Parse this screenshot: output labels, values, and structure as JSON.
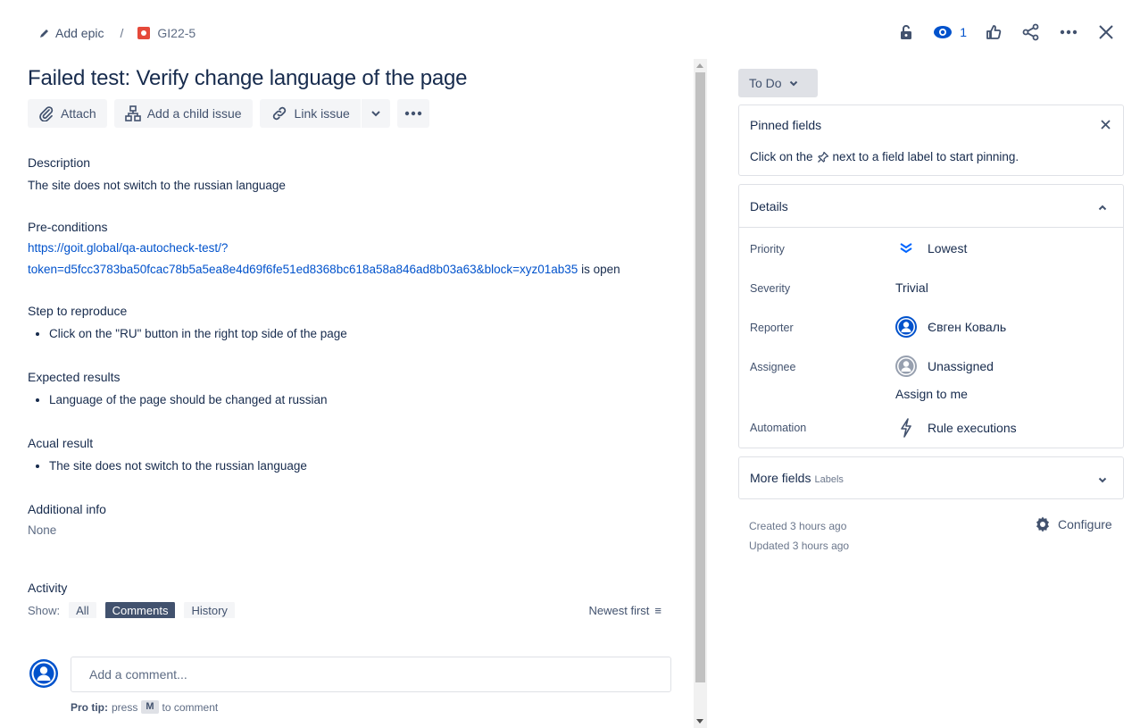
{
  "breadcrumb": {
    "add_epic": "Add epic",
    "separator": "/",
    "issue_key": "GI22-5"
  },
  "top_actions": {
    "watch_count": "1"
  },
  "issue": {
    "title": "Failed test: Verify change language of the page"
  },
  "toolbar": {
    "attach": "Attach",
    "add_child": "Add a child issue",
    "link_issue": "Link issue"
  },
  "sections": {
    "description_h": "Description",
    "description_p": "The site does not switch to the russian language",
    "precond_h": "Pre-conditions",
    "precond_link_1": "https://goit.global/qa-autocheck-test/?",
    "precond_link_2": "token=d5fcc3783ba50fcac78b5a5ea8e4d69f6fe51ed8368bc618a58a846ad8b03a63&block=xyz01ab35",
    "precond_suffix": " is open",
    "steps_h": "Step to reproduce",
    "steps_item": "Click on the \"RU\" button in the right top side of the page",
    "expected_h": "Expected results",
    "expected_item": "Language of the page should be changed at russian",
    "actual_h": "Acual result",
    "actual_item": "The site does not switch to the russian language",
    "additional_h": "Additional info",
    "additional_p": "None"
  },
  "activity": {
    "title": "Activity",
    "show_label": "Show:",
    "all": "All",
    "comments": "Comments",
    "history": "History",
    "sort": "Newest first"
  },
  "comment": {
    "placeholder": "Add a comment...",
    "protip_bold": "Pro tip:",
    "protip_press": "press",
    "protip_key": "M",
    "protip_tail": "to comment"
  },
  "status": {
    "label": "To Do"
  },
  "pinned": {
    "title": "Pinned fields",
    "text_before": "Click on the",
    "text_after": "next to a field label to start pinning."
  },
  "details": {
    "title": "Details",
    "priority_label": "Priority",
    "priority_value": "Lowest",
    "severity_label": "Severity",
    "severity_value": "Trivial",
    "reporter_label": "Reporter",
    "reporter_value": "Євген Коваль",
    "assignee_label": "Assignee",
    "assignee_value": "Unassigned",
    "assign_to_me": "Assign to me",
    "automation_label": "Automation",
    "automation_value": "Rule executions"
  },
  "more_fields": {
    "title": "More fields",
    "sub": "Labels"
  },
  "meta": {
    "created": "Created 3 hours ago",
    "updated": "Updated 3 hours ago",
    "configure": "Configure"
  },
  "colors": {
    "link": "#0052cc",
    "text": "#172b4d",
    "subtle": "#42526e",
    "bug": "#e5493a"
  }
}
